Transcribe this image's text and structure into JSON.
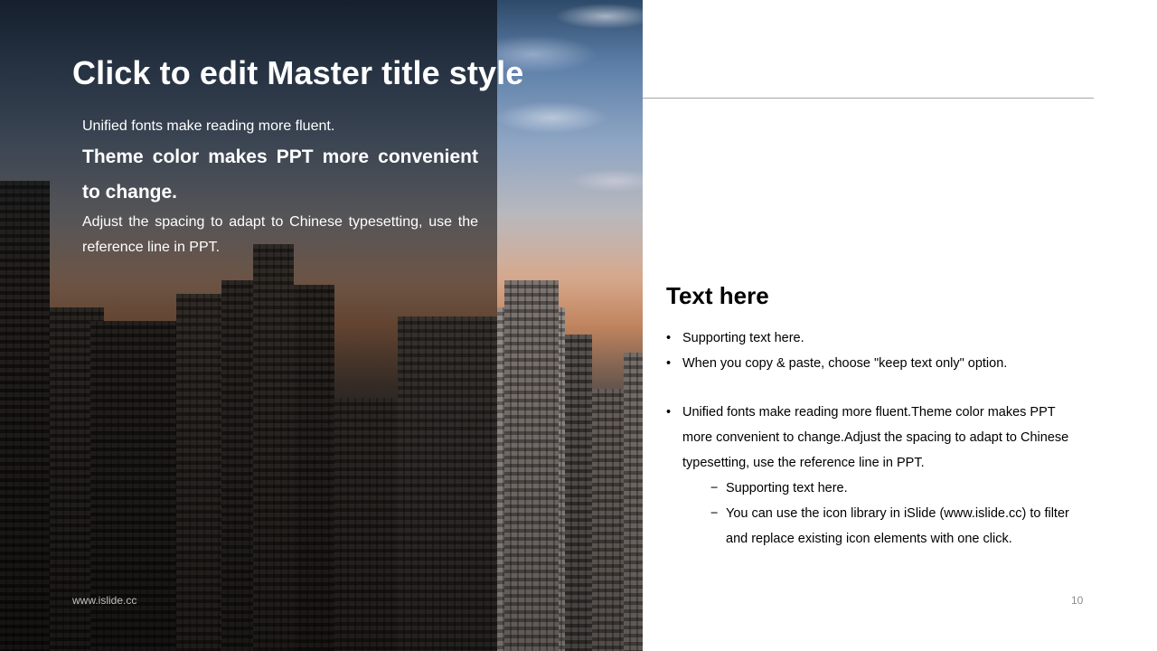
{
  "slide": {
    "title": "Click to edit Master title style",
    "left_body": {
      "line1": "Unified fonts make reading more fluent.",
      "line2": "Theme color makes PPT more convenient to change.",
      "line3": "Adjust the spacing to adapt to Chinese typesetting, use the reference line in PPT."
    },
    "right": {
      "heading": "Text here",
      "bullets": [
        "Supporting text here.",
        "When you copy & paste, choose \"keep text only\" option.",
        "Unified fonts make reading more fluent.Theme color makes PPT more convenient to change.Adjust the spacing to adapt to Chinese typesetting, use the reference line in PPT."
      ],
      "sub_bullets": [
        "Supporting text here.",
        "You can use the icon library in iSlide (www.islide.cc) to filter and replace existing icon elements with one click."
      ],
      "bullet_glyph": "•",
      "dash_glyph": "−"
    },
    "footer": {
      "website": "www.islide.cc",
      "page_number": "10"
    }
  }
}
